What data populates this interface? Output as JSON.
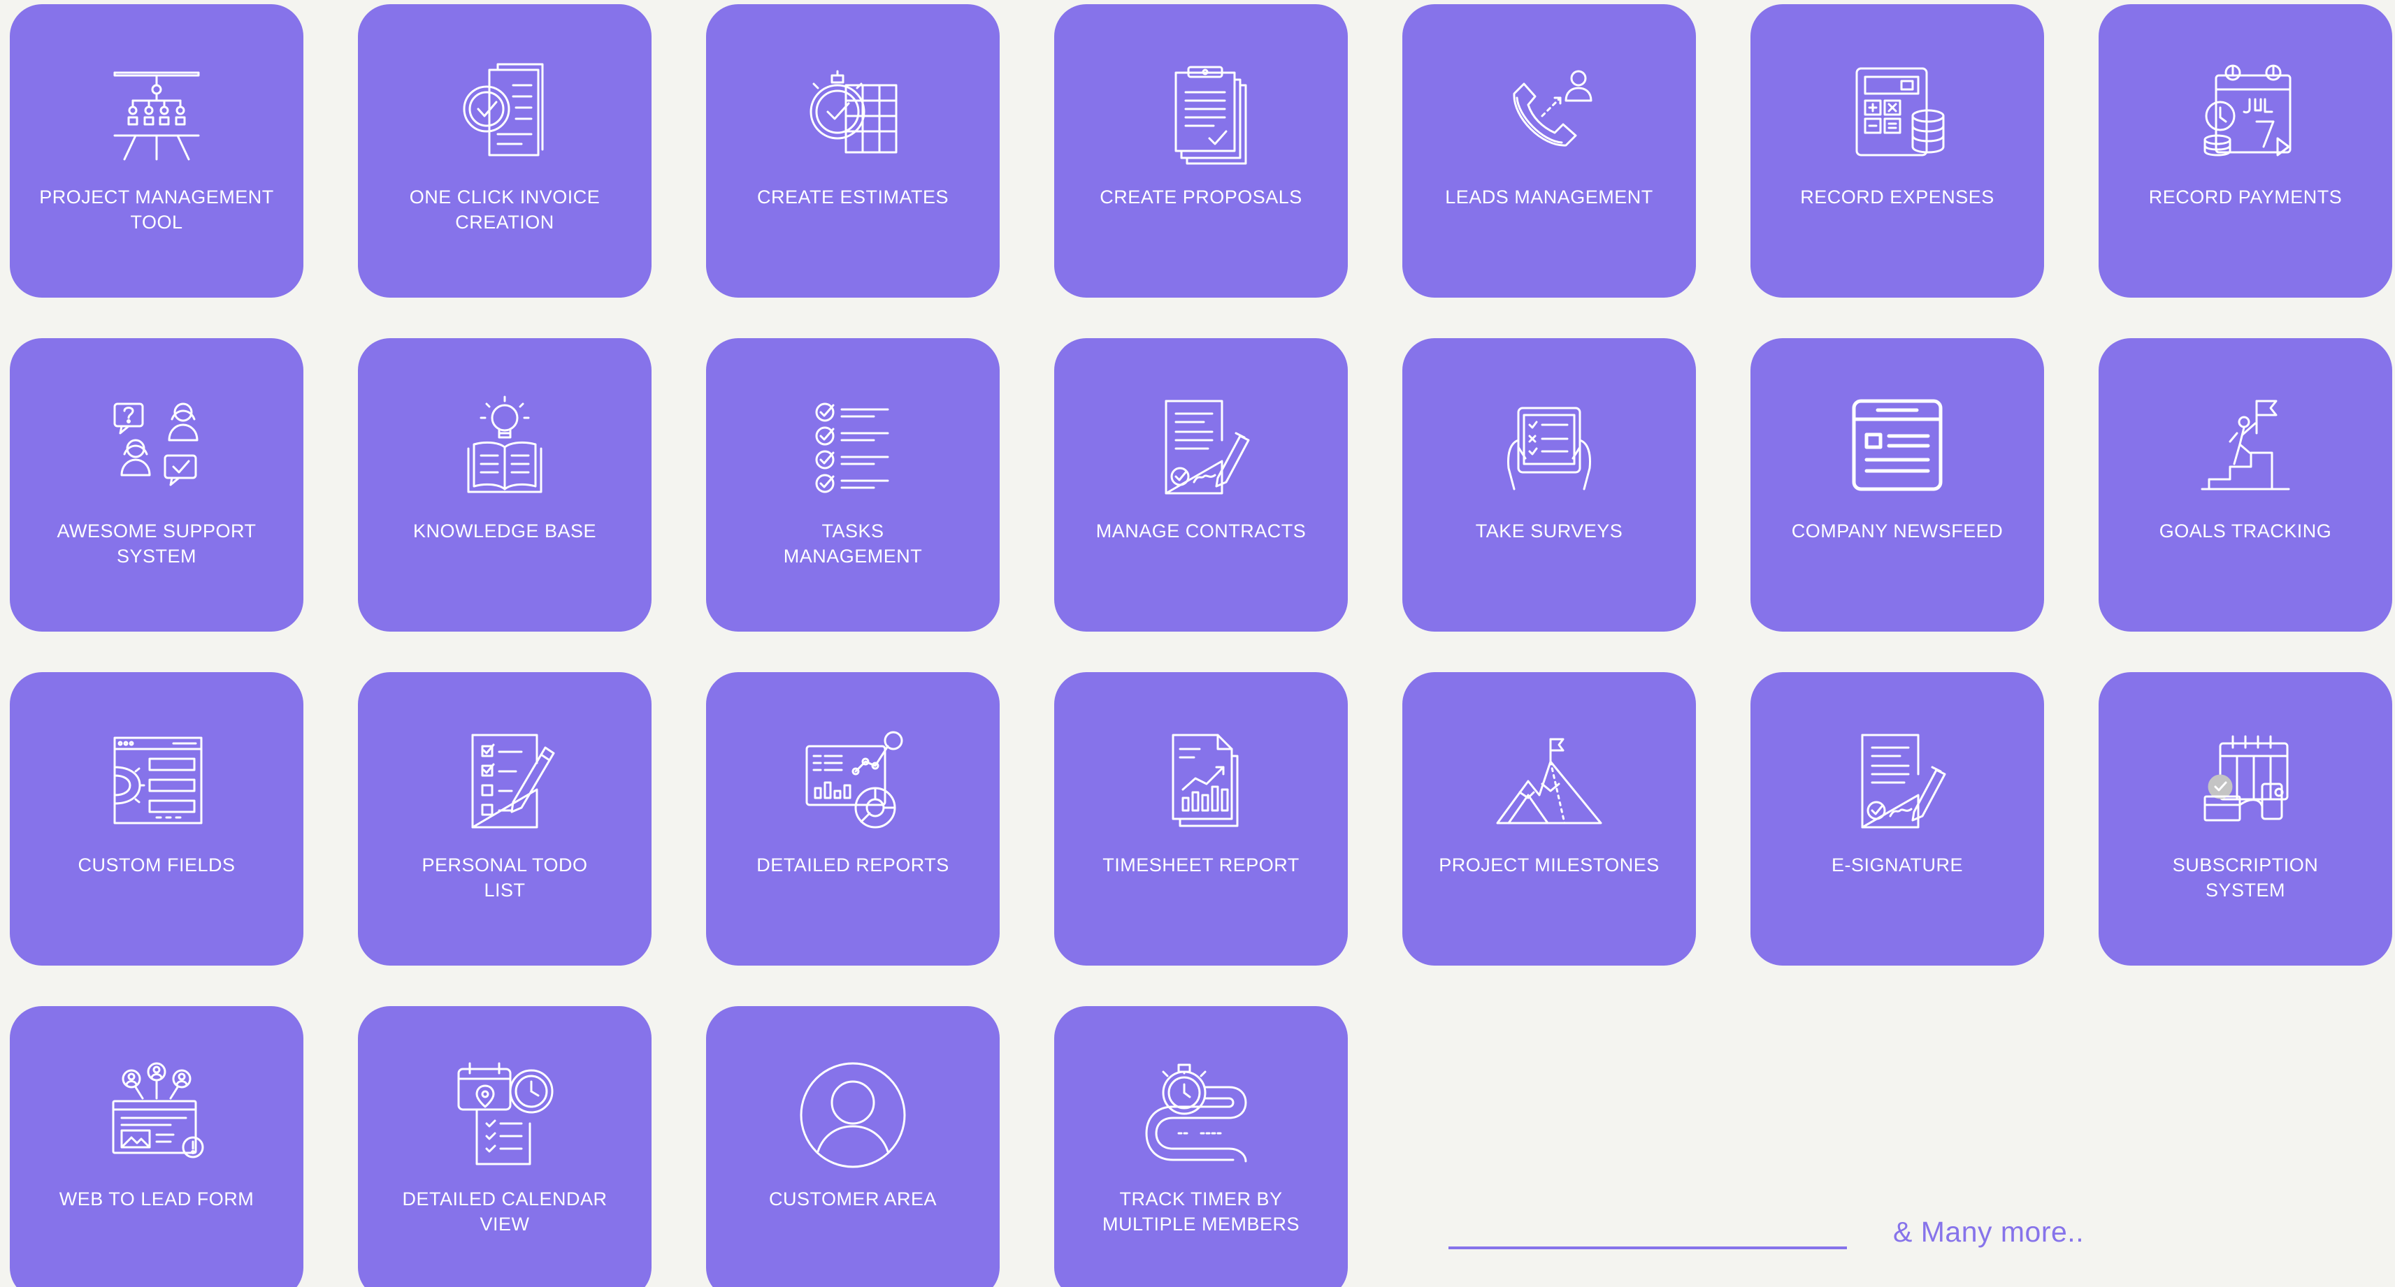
{
  "features": [
    {
      "label": "PROJECT MANAGEMENT\nTOOL",
      "icon": "whiteboard-org-chart-icon"
    },
    {
      "label": "ONE CLICK INVOICE\nCREATION",
      "icon": "invoice-check-icon"
    },
    {
      "label": "CREATE ESTIMATES",
      "icon": "stopwatch-sheet-icon"
    },
    {
      "label": "CREATE PROPOSALS",
      "icon": "clipboard-documents-icon"
    },
    {
      "label": "LEADS MANAGEMENT",
      "icon": "phone-contact-icon"
    },
    {
      "label": "RECORD EXPENSES",
      "icon": "calculator-coins-icon"
    },
    {
      "label": "RECORD PAYMENTS",
      "icon": "calendar-coins-icon"
    },
    {
      "label": "AWESOME SUPPORT\nSYSTEM",
      "icon": "support-people-icon"
    },
    {
      "label": "KNOWLEDGE BASE",
      "icon": "book-lightbulb-icon"
    },
    {
      "label": "TASKS\nMANAGEMENT",
      "icon": "checklist-icon"
    },
    {
      "label": "MANAGE CONTRACTS",
      "icon": "contract-pen-icon"
    },
    {
      "label": "TAKE SURVEYS",
      "icon": "survey-tablet-icon"
    },
    {
      "label": "COMPANY NEWSFEED",
      "icon": "newsfeed-window-icon"
    },
    {
      "label": "GOALS TRACKING",
      "icon": "goal-flag-icon"
    },
    {
      "label": "CUSTOM FIELDS",
      "icon": "custom-fields-gear-icon"
    },
    {
      "label": "PERSONAL TODO\nLIST",
      "icon": "todo-list-pencil-icon"
    },
    {
      "label": "DETAILED REPORTS",
      "icon": "report-chart-icon"
    },
    {
      "label": "TIMESHEET REPORT",
      "icon": "timesheet-chart-icon"
    },
    {
      "label": "PROJECT MILESTONES",
      "icon": "mountain-flag-icon"
    },
    {
      "label": "E-SIGNATURE",
      "icon": "document-signature-icon"
    },
    {
      "label": "SUBSCRIPTION\nSYSTEM",
      "icon": "subscription-calendar-icon"
    },
    {
      "label": "WEB TO LEAD FORM",
      "icon": "web-form-users-icon"
    },
    {
      "label": "DETAILED CALENDAR\nVIEW",
      "icon": "calendar-clock-icon"
    },
    {
      "label": "CUSTOMER AREA",
      "icon": "user-circle-icon"
    },
    {
      "label": "TRACK TIMER BY\nMULTIPLE MEMBERS",
      "icon": "timer-track-icon"
    }
  ],
  "more_text": "& Many more..",
  "colors": {
    "tile": "#8673ea",
    "background": "#f4f4f0",
    "icon": "#ffffff"
  }
}
